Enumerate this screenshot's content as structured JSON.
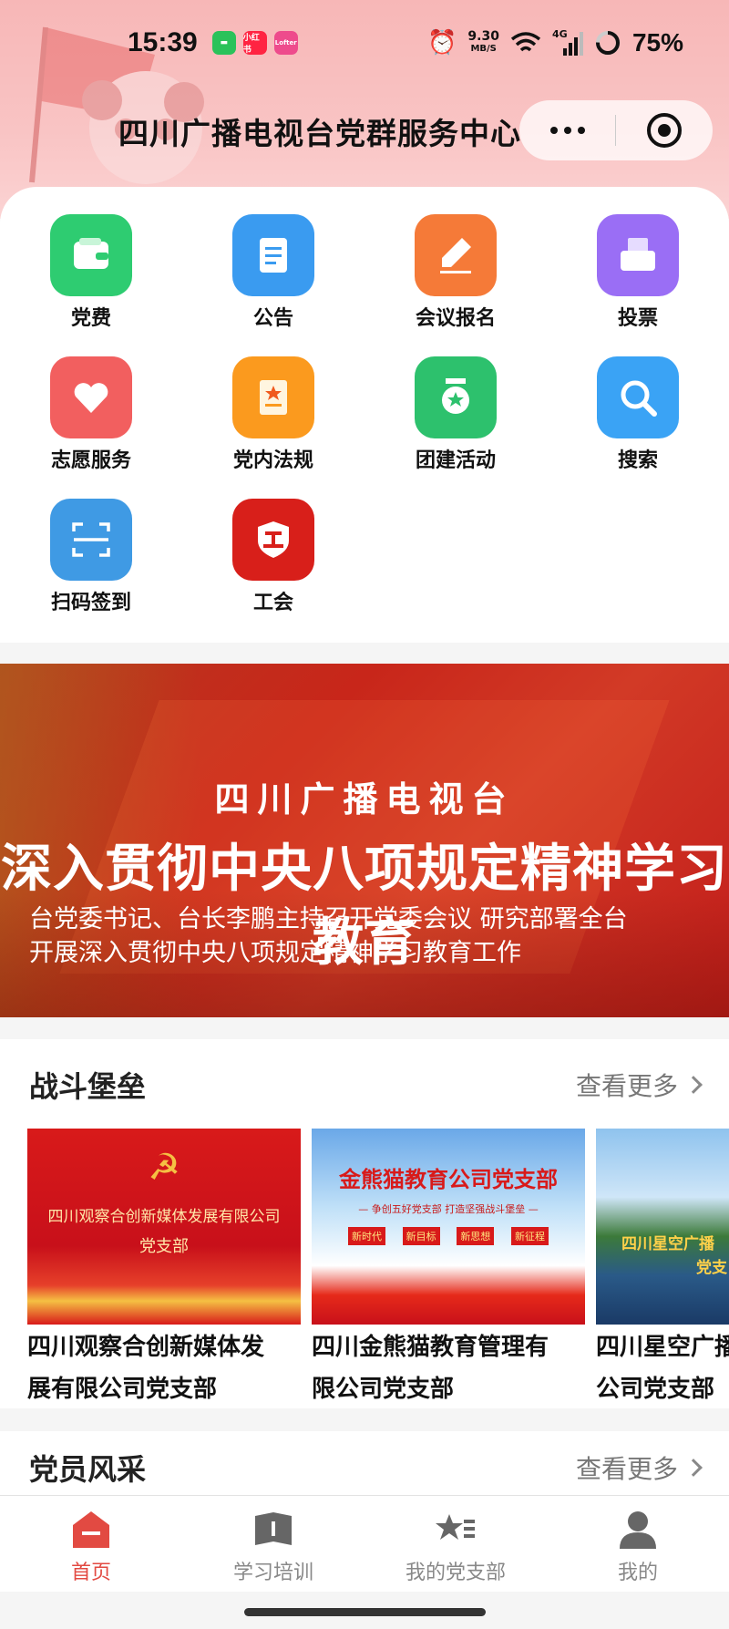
{
  "status": {
    "time": "15:39",
    "apps": [
      "小红书",
      "Lofter"
    ],
    "net_speed_value": "9.30",
    "net_speed_unit": "MB/S",
    "net_type": "4G",
    "battery": "75%"
  },
  "header": {
    "title": "四川广播电视台党群服务中心"
  },
  "grid": [
    {
      "label": "党费",
      "icon": "wallet-icon",
      "color": "#2ecc71"
    },
    {
      "label": "公告",
      "icon": "document-icon",
      "color": "#3a9bf0"
    },
    {
      "label": "会议报名",
      "icon": "pen-icon",
      "color": "#f57a38"
    },
    {
      "label": "投票",
      "icon": "ballot-box-icon",
      "color": "#9a6ef5"
    },
    {
      "label": "志愿服务",
      "icon": "heart-icon",
      "color": "#f25f5f"
    },
    {
      "label": "党内法规",
      "icon": "rulebook-icon",
      "color": "#fb9a1e"
    },
    {
      "label": "团建活动",
      "icon": "medal-icon",
      "color": "#2dc16d"
    },
    {
      "label": "搜索",
      "icon": "search-icon",
      "color": "#3aa3f5"
    },
    {
      "label": "扫码签到",
      "icon": "scan-icon",
      "color": "#3f9ae4"
    },
    {
      "label": "工会",
      "icon": "union-shield-icon",
      "color": "#d81f1a"
    }
  ],
  "banner": {
    "subtitle": "四川广播电视台",
    "title": "深入贯彻中央八项规定精神学习教育",
    "desc_line1": "台党委书记、台长李鹏主持召开党委会议 研究部署全台",
    "desc_line2": "开展深入贯彻中央八项规定精神学习教育工作"
  },
  "fortress": {
    "title": "战斗堡垒",
    "more": "查看更多",
    "cards": [
      {
        "title_line1": "四川观察合创新媒体发",
        "title_line2": "展有限公司党支部",
        "img_text1": "四川观察合创新媒体发展有限公司",
        "img_text2": "党支部"
      },
      {
        "title_line1": "四川金熊猫教育管理有",
        "title_line2": "限公司党支部",
        "img_text1": "金熊猫教育公司党支部",
        "img_text2": "— 争创五好党支部 打造坚强战斗堡垒 —",
        "tags": [
          "新时代",
          "新目标",
          "新思想",
          "新征程"
        ]
      },
      {
        "title_line1": "四川星空广播",
        "title_line2": "公司党支部",
        "img_text1": "四川星空广播",
        "img_text2": "党支"
      }
    ]
  },
  "members": {
    "title": "党员风采",
    "more": "查看更多"
  },
  "tabs": [
    {
      "label": "首页",
      "icon": "home-icon",
      "active": true
    },
    {
      "label": "学习培训",
      "icon": "book-icon",
      "active": false
    },
    {
      "label": "我的党支部",
      "icon": "star-list-icon",
      "active": false
    },
    {
      "label": "我的",
      "icon": "user-icon",
      "active": false
    }
  ],
  "colors": {
    "accent": "#e24a42",
    "header_pink": "#f7b7b7",
    "banner_red": "#c8261a"
  }
}
